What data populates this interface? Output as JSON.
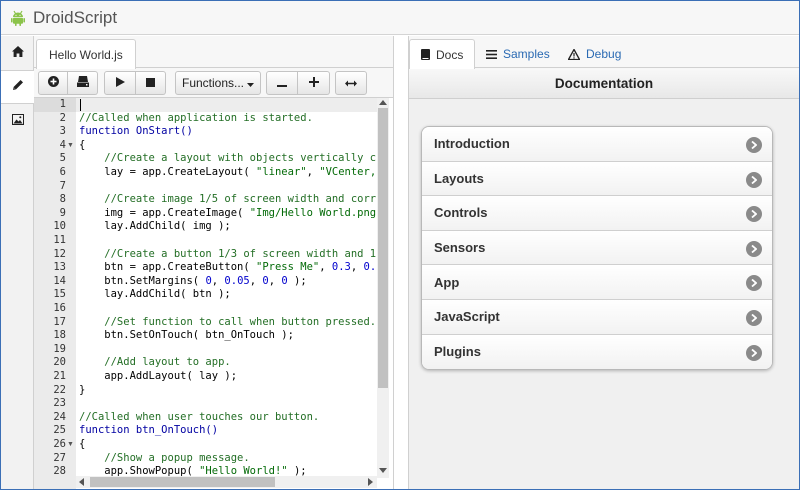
{
  "app": {
    "title": "DroidScript",
    "brand_color": "#8bc34a"
  },
  "sidebar": {
    "items": [
      {
        "icon": "home-icon"
      },
      {
        "icon": "pencil-icon"
      },
      {
        "icon": "image-icon"
      }
    ]
  },
  "editor": {
    "file_tab": "Hello World.js",
    "toolbar": {
      "functions_label": "Functions...",
      "buttons": [
        "plus-circle-icon",
        "save-icon",
        "play-icon",
        "stop-icon",
        "minus-icon",
        "plus-icon",
        "arrows-horizontal-icon"
      ]
    },
    "line_numbers": [
      "1",
      "2",
      "3",
      "4",
      "5",
      "6",
      "7",
      "8",
      "9",
      "10",
      "11",
      "12",
      "13",
      "14",
      "15",
      "16",
      "17",
      "18",
      "19",
      "20",
      "21",
      "22",
      "23",
      "24",
      "25",
      "26",
      "27",
      "28"
    ],
    "fold_markers": [
      "4",
      "26"
    ],
    "code": [
      "",
      "//Called when application is started.",
      "function OnStart()",
      "{",
      "    //Create a layout with objects vertically c",
      "    lay = app.CreateLayout( \"linear\", \"VCenter,",
      "",
      "    //Create image 1/5 of screen width and corr",
      "    img = app.CreateImage( \"Img/Hello World.png",
      "    lay.AddChild( img );",
      "",
      "    //Create a button 1/3 of screen width and 1",
      "    btn = app.CreateButton( \"Press Me\", 0.3, 0.",
      "    btn.SetMargins( 0, 0.05, 0, 0 );",
      "    lay.AddChild( btn );",
      "",
      "    //Set function to call when button pressed.",
      "    btn.SetOnTouch( btn_OnTouch );",
      "",
      "    //Add layout to app.",
      "    app.AddLayout( lay );",
      "}",
      "",
      "//Called when user touches our button.",
      "function btn_OnTouch()",
      "{",
      "    //Show a popup message.",
      "    app.ShowPopup( \"Hello World!\" );"
    ]
  },
  "docs": {
    "tabs": [
      {
        "label": "Docs",
        "icon": "book-icon"
      },
      {
        "label": "Samples",
        "icon": "list-icon"
      },
      {
        "label": "Debug",
        "icon": "warning-icon"
      }
    ],
    "header": "Documentation",
    "items": [
      "Introduction",
      "Layouts",
      "Controls",
      "Sensors",
      "App",
      "JavaScript",
      "Plugins"
    ]
  }
}
